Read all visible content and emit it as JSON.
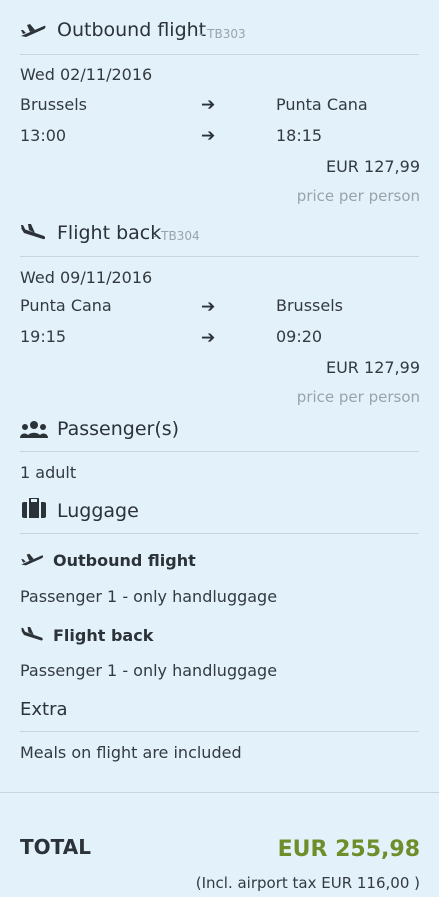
{
  "outbound": {
    "title": "Outbound flight",
    "code": "- TB303",
    "date": "Wed 02/11/2016",
    "from": "Brussels",
    "to": "Punta Cana",
    "dep_time": "13:00",
    "arr_time": "18:15",
    "price": "EUR 127,99",
    "price_note": "price per person",
    "icon": "plane-takeoff-icon"
  },
  "return": {
    "title": "Flight back",
    "code": "- TB304",
    "date": "Wed 09/11/2016",
    "from": "Punta Cana",
    "to": "Brussels",
    "dep_time": "19:15",
    "arr_time": "09:20",
    "price": "EUR 127,99",
    "price_note": "price per person",
    "icon": "plane-landing-icon"
  },
  "passengers": {
    "title": "Passenger(s)",
    "value": "1 adult",
    "icon": "passengers-icon"
  },
  "luggage": {
    "title": "Luggage",
    "icon": "suitcase-icon",
    "outbound_label": "Outbound flight",
    "outbound_value": "Passenger 1 - only handluggage",
    "return_label": "Flight back",
    "return_value": "Passenger 1 - only handluggage"
  },
  "extra": {
    "title": "Extra",
    "value": "Meals on flight are included"
  },
  "total": {
    "label": "TOTAL",
    "value": "EUR 255,98",
    "tax_note": "(Incl. airport tax EUR 116,00 )"
  },
  "colors": {
    "background": "#e3f1fb",
    "total_accent": "#6f8e2a",
    "muted": "#9aa3aa"
  }
}
